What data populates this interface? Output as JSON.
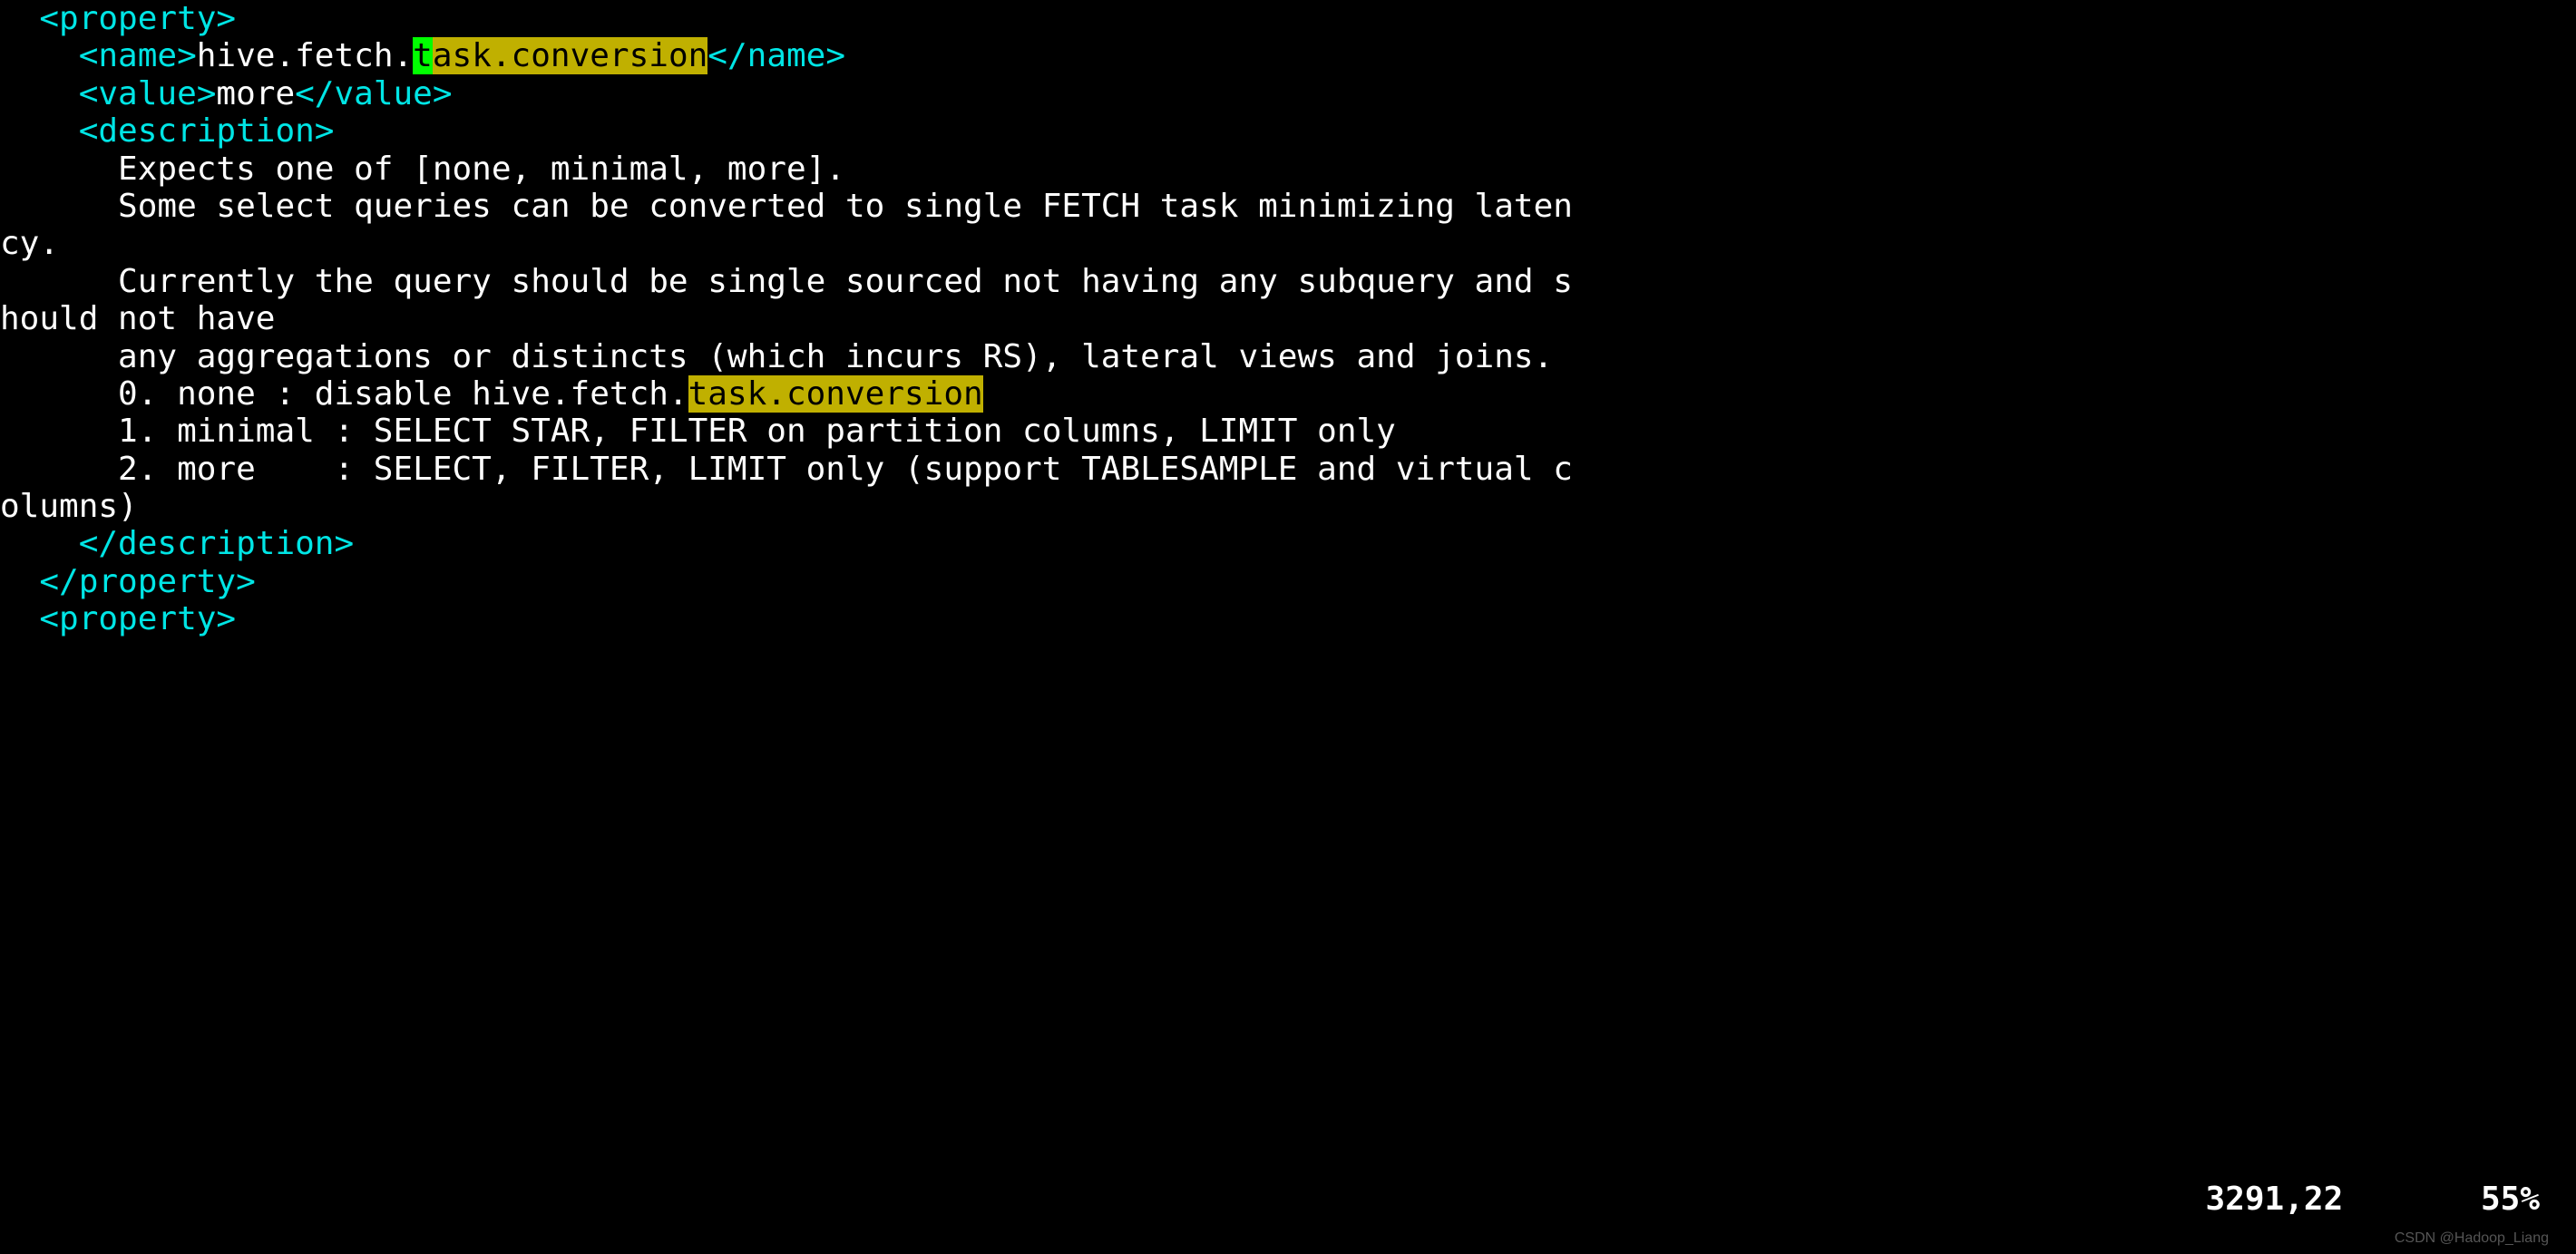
{
  "tags": {
    "property_open": "<property>",
    "property_close": "</property>",
    "name_open": "<name>",
    "name_close": "</name>",
    "value_open": "<value>",
    "value_close": "</value>",
    "description_open": "<description>",
    "description_close": "</description>"
  },
  "indent": {
    "level1": "  ",
    "level2": "    ",
    "level3": "      ",
    "wrap0": ""
  },
  "name_line": {
    "prefix": "hive.fetch.",
    "cursor_char": "t",
    "hl_rest": "ask.conversion"
  },
  "value_text": "more",
  "desc": {
    "line1": "Expects one of [none, minimal, more].",
    "line2": "Some select queries can be converted to single FETCH task minimizing laten",
    "line2_wrap": "cy.",
    "line3": "Currently the query should be single sourced not having any subquery and s",
    "line3_wrap": "hould not have",
    "line4": "any aggregations or distincts (which incurs RS), lateral views and joins.",
    "line5_pre": "0. none : disable hive.fetch.",
    "line5_hl": "task.conversion",
    "line6": "1. minimal : SELECT STAR, FILTER on partition columns, LIMIT only",
    "line7": "2. more    : SELECT, FILTER, LIMIT only (support TABLESAMPLE and virtual c",
    "line7_wrap": "olumns)"
  },
  "status": {
    "pos": "3291,22",
    "gap": "       ",
    "pct": "55%"
  },
  "watermark": "CSDN @Hadoop_Liang"
}
